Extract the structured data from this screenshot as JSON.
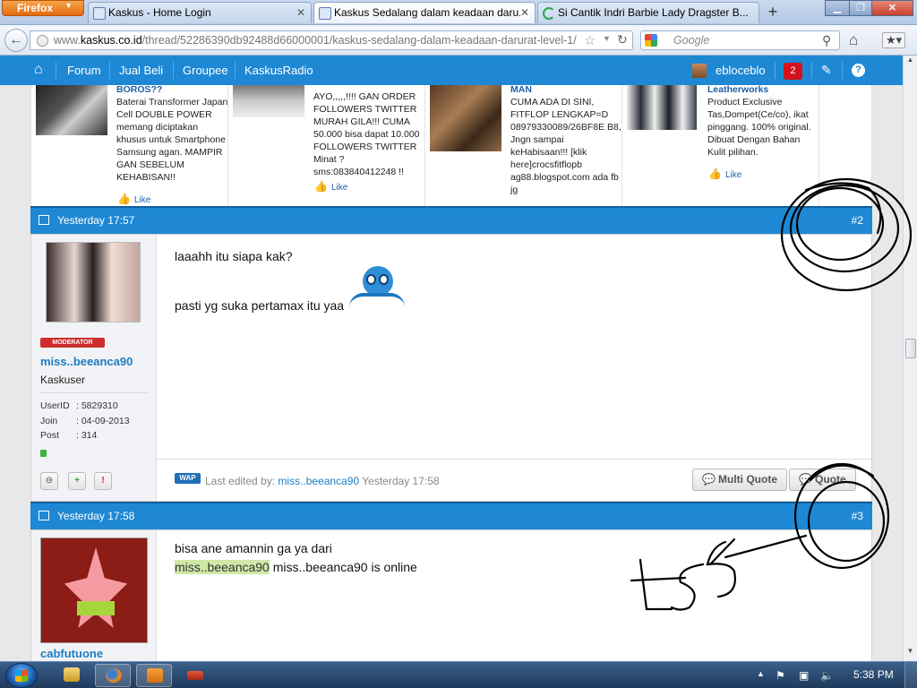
{
  "browser": {
    "menu_button": "Firefox",
    "tabs": [
      {
        "title": "Kaskus - Home Login",
        "active": false
      },
      {
        "title": "Kaskus Sedalang dalam keadaan daru...",
        "active": true
      },
      {
        "title": "Si Cantik Indri Barbie Lady Dragster B...",
        "active": false
      }
    ],
    "url_prefix": "www.",
    "url_host": "kaskus.co.id",
    "url_path": "/thread/52286390db92488d66000001/kaskus-sedalang-dalam-keadaan-darurat-level-1/",
    "search_placeholder": "Google"
  },
  "kaskus_nav": {
    "items": [
      "Forum",
      "Jual Beli",
      "Groupee",
      "KaskusRadio"
    ],
    "username": "ebloceblo",
    "notification_count": "2"
  },
  "ads": [
    {
      "title": "BOROS??",
      "body": "Baterai Transformer Japan Cell DOUBLE POWER memang diciptakan khusus untuk Smartphone Samsung agan. MAMPIR GAN SEBELUM KEHABISAN!!",
      "like": "Like"
    },
    {
      "title": "",
      "body": "AYO,,,,,!!!! GAN ORDER FOLLOWERS TWITTER MURAH GILA!!! CUMA 50.000 bisa dapat 10.000 FOLLOWERS TWITTER Minat ? sms:083840412248 !!",
      "like": "Like"
    },
    {
      "title": "MAN",
      "body": "CUMA ADA DI SINI, FITFLOP LENGKAP=D 08979330089/26BF8E B8, Jngn sampai keHabisaan!!! [klik here]crocsfitflopb ag88.blogspot.com ada fb jg",
      "like": ""
    },
    {
      "title": "Leatherworks",
      "body": "Product Exclusive Tas,Dompet(Ce/co), ikat pinggang. 100% original. Dibuat Dengan Bahan Kulit pilihan.",
      "like": "Like"
    }
  ],
  "posts": [
    {
      "time": "Yesterday 17:57",
      "number": "#2",
      "badge": "MODERATOR",
      "username": "miss..beeanca90",
      "usertitle": "Kaskuser",
      "stats": [
        {
          "label": "UserID",
          "value": ": 5829310"
        },
        {
          "label": "Join",
          "value": ": 04-09-2013"
        },
        {
          "label": "Post",
          "value": ": 314"
        }
      ],
      "lines": [
        "laaahh itu siapa kak?",
        "pasti yg suka pertamax itu yaa"
      ],
      "edited_label": "Last edited by:",
      "edited_by": "miss..beeanca90",
      "edited_time": "Yesterday 17:58",
      "wap_label": "WAP",
      "buttons": [
        "Multi Quote",
        "Quote"
      ]
    },
    {
      "time": "Yesterday 17:58",
      "number": "#3",
      "username": "cabfutuone",
      "lines": [
        "bisa ane amannin ga ya dari"
      ],
      "quote_user": "miss..beeanca90",
      "quote_rest": " miss..beeanca90 is online"
    }
  ],
  "taskbar": {
    "clock": "5:38 PM"
  }
}
